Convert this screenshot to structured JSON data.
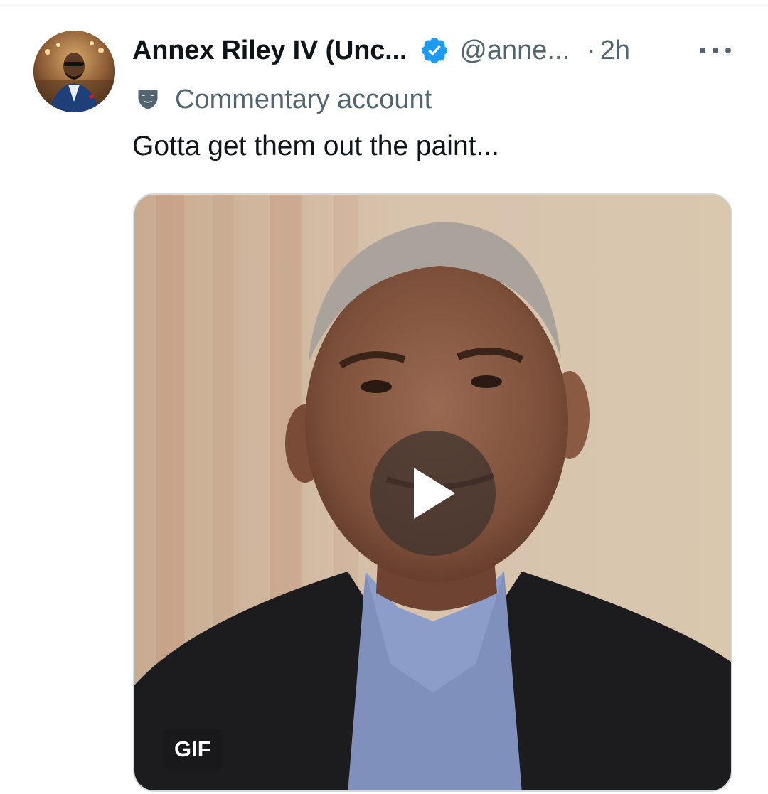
{
  "tweet": {
    "author": {
      "display_name": "Annex Riley IV (Unc...",
      "handle": "@anne...",
      "verified": true,
      "avatar": "profile-photo"
    },
    "separator": "·",
    "timestamp": "2h",
    "more_icon": "more-horizontal-icon",
    "account_label": {
      "icon": "theater-mask-icon",
      "text": "Commentary account"
    },
    "text": "Gotta get them out the paint...",
    "media": {
      "kind": "gif",
      "badge": "GIF",
      "play_icon": "play-icon"
    }
  },
  "colors": {
    "primary_text": "#0f1419",
    "secondary_text": "#536471",
    "verified_blue": "#1d9bf0",
    "border": "#cfd9de"
  }
}
